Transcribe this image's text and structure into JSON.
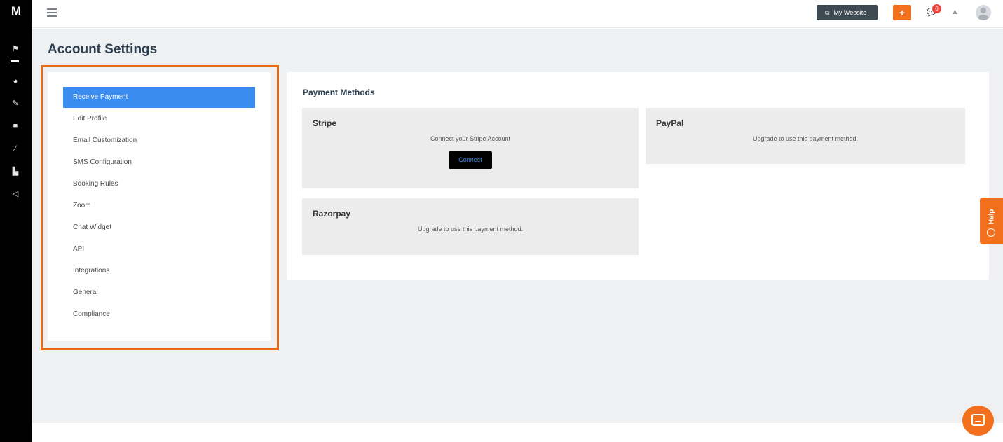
{
  "app": {
    "logo_text": "M"
  },
  "sidebar_icons": [
    "flag-icon",
    "pie-chart-icon",
    "user-edit-icon",
    "video-icon",
    "brush-icon",
    "analytics-icon",
    "megaphone-icon"
  ],
  "topbar": {
    "my_website_label": "My Website",
    "add_label": "+",
    "notification_count": "0"
  },
  "page": {
    "title": "Account Settings"
  },
  "settings_menu": {
    "items": [
      {
        "label": "Receive Payment",
        "active": true
      },
      {
        "label": "Edit Profile"
      },
      {
        "label": "Email Customization"
      },
      {
        "label": "SMS Configuration"
      },
      {
        "label": "Booking Rules"
      },
      {
        "label": "Zoom"
      },
      {
        "label": "Chat Widget"
      },
      {
        "label": "API"
      },
      {
        "label": "Integrations"
      },
      {
        "label": "General"
      },
      {
        "label": "Compliance"
      }
    ]
  },
  "payment_methods": {
    "title": "Payment Methods",
    "stripe": {
      "title": "Stripe",
      "message": "Connect your Stripe Account",
      "button": "Connect"
    },
    "paypal": {
      "title": "PayPal",
      "message": "Upgrade to use this payment method."
    },
    "razorpay": {
      "title": "Razorpay",
      "message": "Upgrade to use this payment method."
    }
  },
  "help_tab": {
    "label": "Help"
  },
  "colors": {
    "accent": "#f26f1d",
    "active": "#3b8cf0",
    "highlight": "#ea6a15"
  }
}
